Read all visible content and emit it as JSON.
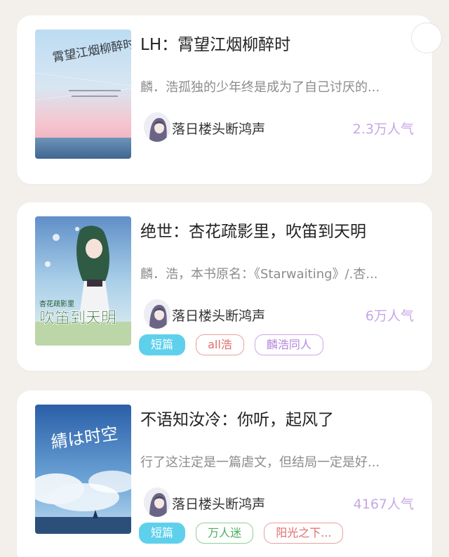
{
  "books": [
    {
      "title": "LH：霄望江烟柳醉时",
      "description": "麟．浩孤独的少年终是成为了自己讨厌的...",
      "author": "落日楼头断鸿声",
      "popularity": "2.3万人气",
      "cover_text": "霄望江烟柳醉时",
      "tags": []
    },
    {
      "title": "绝世：杏花疏影里，吹笛到天明",
      "description": "麟．浩，本书原名：《Starwaiting》/.杏...",
      "author": "落日楼头断鸿声",
      "popularity": "6万人气",
      "cover_text": "杏花疏影里 吹笛到天明",
      "tags": [
        {
          "label": "短篇",
          "style": "blue"
        },
        {
          "label": "all浩",
          "style": "red"
        },
        {
          "label": "麟浩同人",
          "style": "purple"
        }
      ]
    },
    {
      "title": "不语知汝冷：你听，起风了",
      "description": "行了这注定是一篇虐文，但结局一定是好...",
      "author": "落日楼头断鸿声",
      "popularity": "4167人气",
      "cover_text": "綪は时空",
      "tags": [
        {
          "label": "短篇",
          "style": "blue"
        },
        {
          "label": "万人迷",
          "style": "green"
        },
        {
          "label": "阳光之下...",
          "style": "red"
        }
      ]
    }
  ],
  "colors": {
    "background": "#f3f0ec",
    "card": "#ffffff",
    "popularity": "#c8a6e6",
    "tag_blue": "#5fd0ec",
    "tag_red": "#e06c6c",
    "tag_purple": "#b586df",
    "tag_green": "#4fae62"
  }
}
